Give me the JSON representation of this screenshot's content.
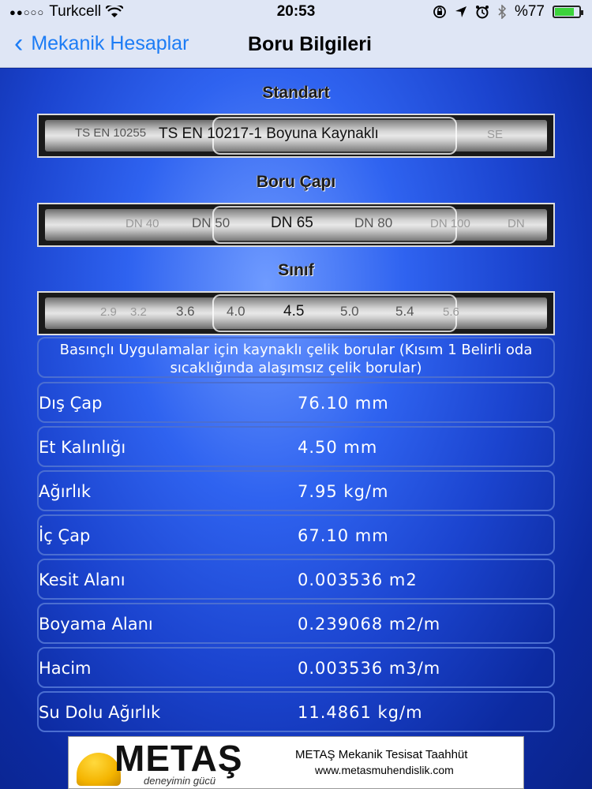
{
  "status_bar": {
    "signal": "●●○○○",
    "carrier": "Turkcell",
    "time": "20:53",
    "battery": "%77"
  },
  "nav": {
    "back_label": "Mekanik Hesaplar",
    "title": "Boru Bilgileri"
  },
  "sections": {
    "standard_label": "Standart",
    "diameter_label": "Boru Çapı",
    "class_label": "Sınıf"
  },
  "pickers": {
    "standard": {
      "prev": "TS EN 10255",
      "selected": "TS EN 10217-1 Boyuna Kaynaklı",
      "next": "SE"
    },
    "diameter": {
      "far_prev": "DN 40",
      "prev": "DN 50",
      "selected": "DN 65",
      "next": "DN 80",
      "far_next": "DN 100",
      "edge": "DN"
    },
    "class": {
      "edge": "2.9",
      "far_prev": "3.2",
      "prev2": "3.6",
      "prev": "4.0",
      "selected": "4.5",
      "next": "5.0",
      "next2": "5.4",
      "far_next": "5.6"
    }
  },
  "description": "Basınçlı Uygulamalar için kaynaklı çelik borular (Kısım 1 Belirli oda sıcaklığında alaşımsız çelik borular)",
  "results": [
    {
      "label": "Dış Çap",
      "value": "76.10 mm"
    },
    {
      "label": "Et Kalınlığı",
      "value": "4.50 mm"
    },
    {
      "label": "Ağırlık",
      "value": "7.95 kg/m"
    },
    {
      "label": "İç Çap",
      "value": "67.10 mm"
    },
    {
      "label": "Kesit Alanı",
      "value": "0.003536 m2"
    },
    {
      "label": "Boyama Alanı",
      "value": "0.239068 m2/m"
    },
    {
      "label": "Hacim",
      "value": "0.003536 m3/m"
    },
    {
      "label": "Su Dolu Ağırlık",
      "value": "11.4861 kg/m"
    }
  ],
  "banner": {
    "brand": "METAŞ",
    "tagline": "deneyimin gücü",
    "company": "METAŞ Mekanik Tesisat Taahhüt",
    "website": "www.metasmuhendislik.com"
  }
}
